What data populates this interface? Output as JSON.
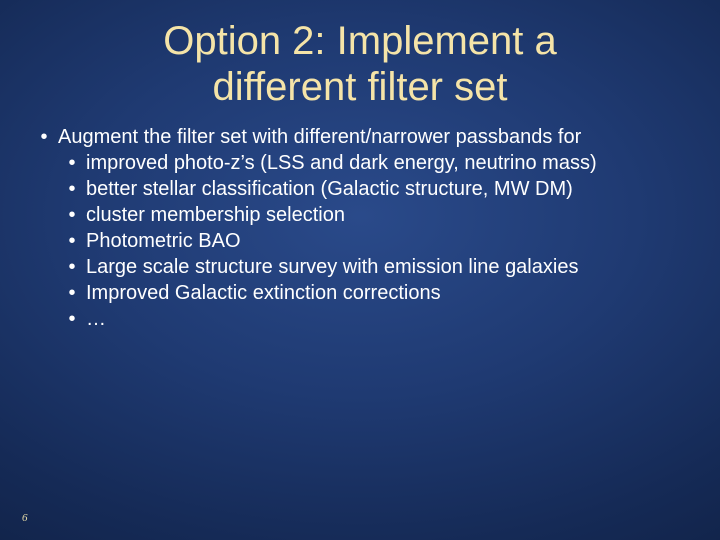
{
  "title_line1": "Option 2: Implement a",
  "title_line2": "different filter set",
  "bullet_char": "•",
  "outer_text": "Augment the filter set with different/narrower passbands for",
  "inner_items": [
    "improved photo-z’s (LSS and dark energy, neutrino mass)",
    "better stellar classification (Galactic structure, MW DM)",
    "cluster membership selection",
    "Photometric BAO",
    "Large scale structure survey with emission line galaxies",
    "Improved Galactic extinction corrections",
    "…"
  ],
  "page_number": "6"
}
